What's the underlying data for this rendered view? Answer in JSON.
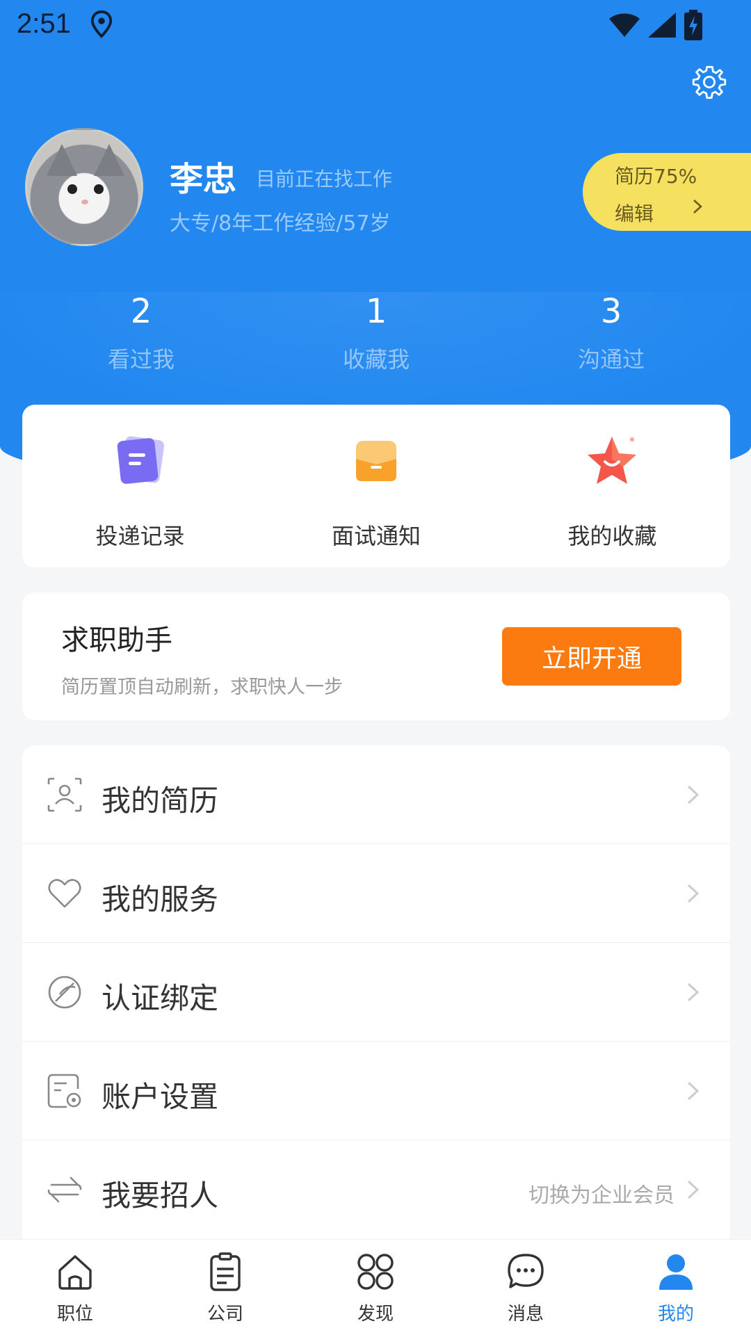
{
  "status_bar": {
    "time": "2:51"
  },
  "profile": {
    "name": "李忠",
    "job_status": "目前正在找工作",
    "meta": "大专/8年工作经验/57岁",
    "resume_percent": "简历75%",
    "edit_label": "编辑"
  },
  "stats": [
    {
      "value": "2",
      "label": "看过我"
    },
    {
      "value": "1",
      "label": "收藏我"
    },
    {
      "value": "3",
      "label": "沟通过"
    }
  ],
  "quick_actions": [
    {
      "label": "投递记录",
      "icon": "document-icon",
      "color": "#7a6cf2"
    },
    {
      "label": "面试通知",
      "icon": "envelope-icon",
      "color": "#f8a12b"
    },
    {
      "label": "我的收藏",
      "icon": "star-icon",
      "color": "#f4574a"
    }
  ],
  "assistant": {
    "title": "求职助手",
    "subtitle": "简历置顶自动刷新，求职快人一步",
    "button": "立即开通"
  },
  "menu": [
    {
      "label": "我的简历",
      "icon": "resume-icon",
      "hint": ""
    },
    {
      "label": "我的服务",
      "icon": "heart-icon",
      "hint": ""
    },
    {
      "label": "认证绑定",
      "icon": "verify-icon",
      "hint": ""
    },
    {
      "label": "账户设置",
      "icon": "account-settings-icon",
      "hint": ""
    },
    {
      "label": "我要招人",
      "icon": "switch-icon",
      "hint": "切换为企业会员"
    }
  ],
  "tabs": [
    {
      "label": "职位",
      "icon": "home-icon",
      "active": false
    },
    {
      "label": "公司",
      "icon": "clipboard-icon",
      "active": false
    },
    {
      "label": "发现",
      "icon": "grid-icon",
      "active": false
    },
    {
      "label": "消息",
      "icon": "chat-icon",
      "active": false
    },
    {
      "label": "我的",
      "icon": "person-icon",
      "active": true
    }
  ],
  "colors": {
    "primary": "#2288f0",
    "accent": "#fc7b10",
    "resume_pill": "#f5e060"
  }
}
